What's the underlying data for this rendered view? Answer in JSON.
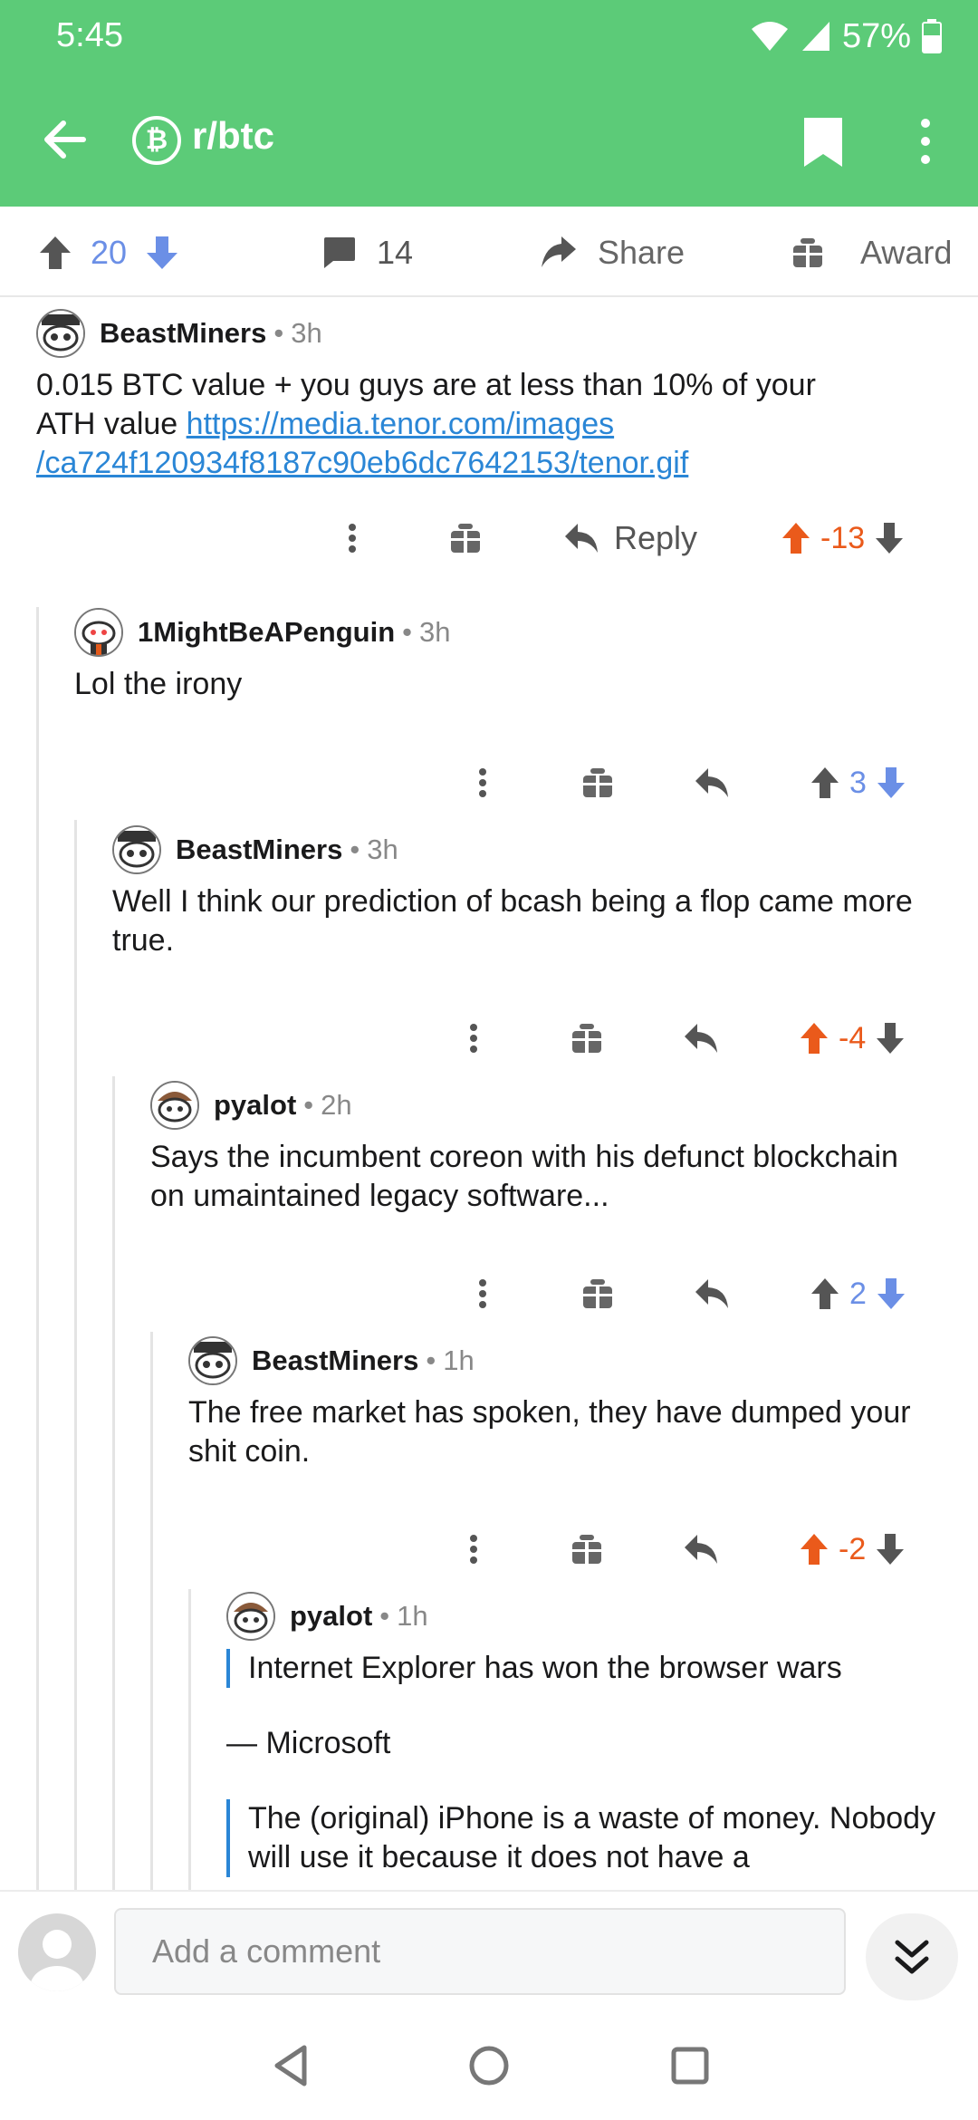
{
  "status_bar": {
    "time": "5:45",
    "battery": "57%"
  },
  "app_bar": {
    "subreddit": "r/btc",
    "sub_icon_glyph": "₿"
  },
  "post_bar": {
    "score": "20",
    "comment_count": "14",
    "share_label": "Share",
    "award_label": "Award"
  },
  "comments": [
    {
      "author": "BeastMiners",
      "age": "3h",
      "body_text": "0.015 BTC value + you guys are at less than 10% of your ATH value ",
      "link_line1": "https://media.tenor.com/images",
      "link_line2": "/ca724f120934f8187c90eb6dc7642153/tenor.gif",
      "score": "-13",
      "reply_label": "Reply"
    },
    {
      "author": "1MightBeAPenguin",
      "age": "3h",
      "body": "Lol the irony",
      "score": "3"
    },
    {
      "author": "BeastMiners",
      "age": "3h",
      "body": "Well I think our prediction of bcash being a flop came more true.",
      "score": "-4"
    },
    {
      "author": "pyalot",
      "age": "2h",
      "body": "Says the incumbent coreon with his defunct blockchain on umaintained legacy software...",
      "score": "2"
    },
    {
      "author": "BeastMiners",
      "age": "1h",
      "body": "The free market has spoken, they have dumped your shit coin.",
      "score": "-2"
    },
    {
      "author": "pyalot",
      "age": "1h",
      "quote1": "Internet Explorer has won the browser wars",
      "attribution1": "— Microsoft",
      "quote2": "The (original) iPhone is a waste of money. Nobody will use it because it does not have a"
    }
  ],
  "composer": {
    "placeholder": "Add a comment"
  },
  "colors": {
    "header_green": "#5ccb78",
    "upvote_orange": "#ea5a1b",
    "downvote_blue": "#6b8fe6",
    "link_blue": "#2a86d6"
  }
}
